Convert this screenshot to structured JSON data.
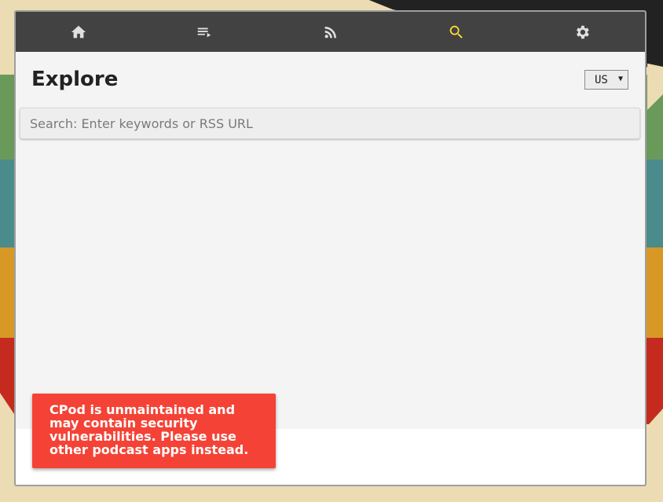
{
  "nav": {
    "items": [
      {
        "icon": "home-icon",
        "active": false
      },
      {
        "icon": "playlist-icon",
        "active": false
      },
      {
        "icon": "rss-feed-icon",
        "active": false
      },
      {
        "icon": "search-icon",
        "active": true
      },
      {
        "icon": "gear-icon",
        "active": false
      }
    ],
    "active_color": "#fdd835",
    "inactive_color": "#e0e0e0"
  },
  "explore": {
    "title": "Explore",
    "region": "US",
    "search_placeholder": "Search: Enter keywords or RSS URL",
    "search_value": ""
  },
  "toast": {
    "message": "CPod is unmaintained and may contain security vulnerabilities. Please use other podcast apps instead.",
    "color": "#f44336"
  }
}
